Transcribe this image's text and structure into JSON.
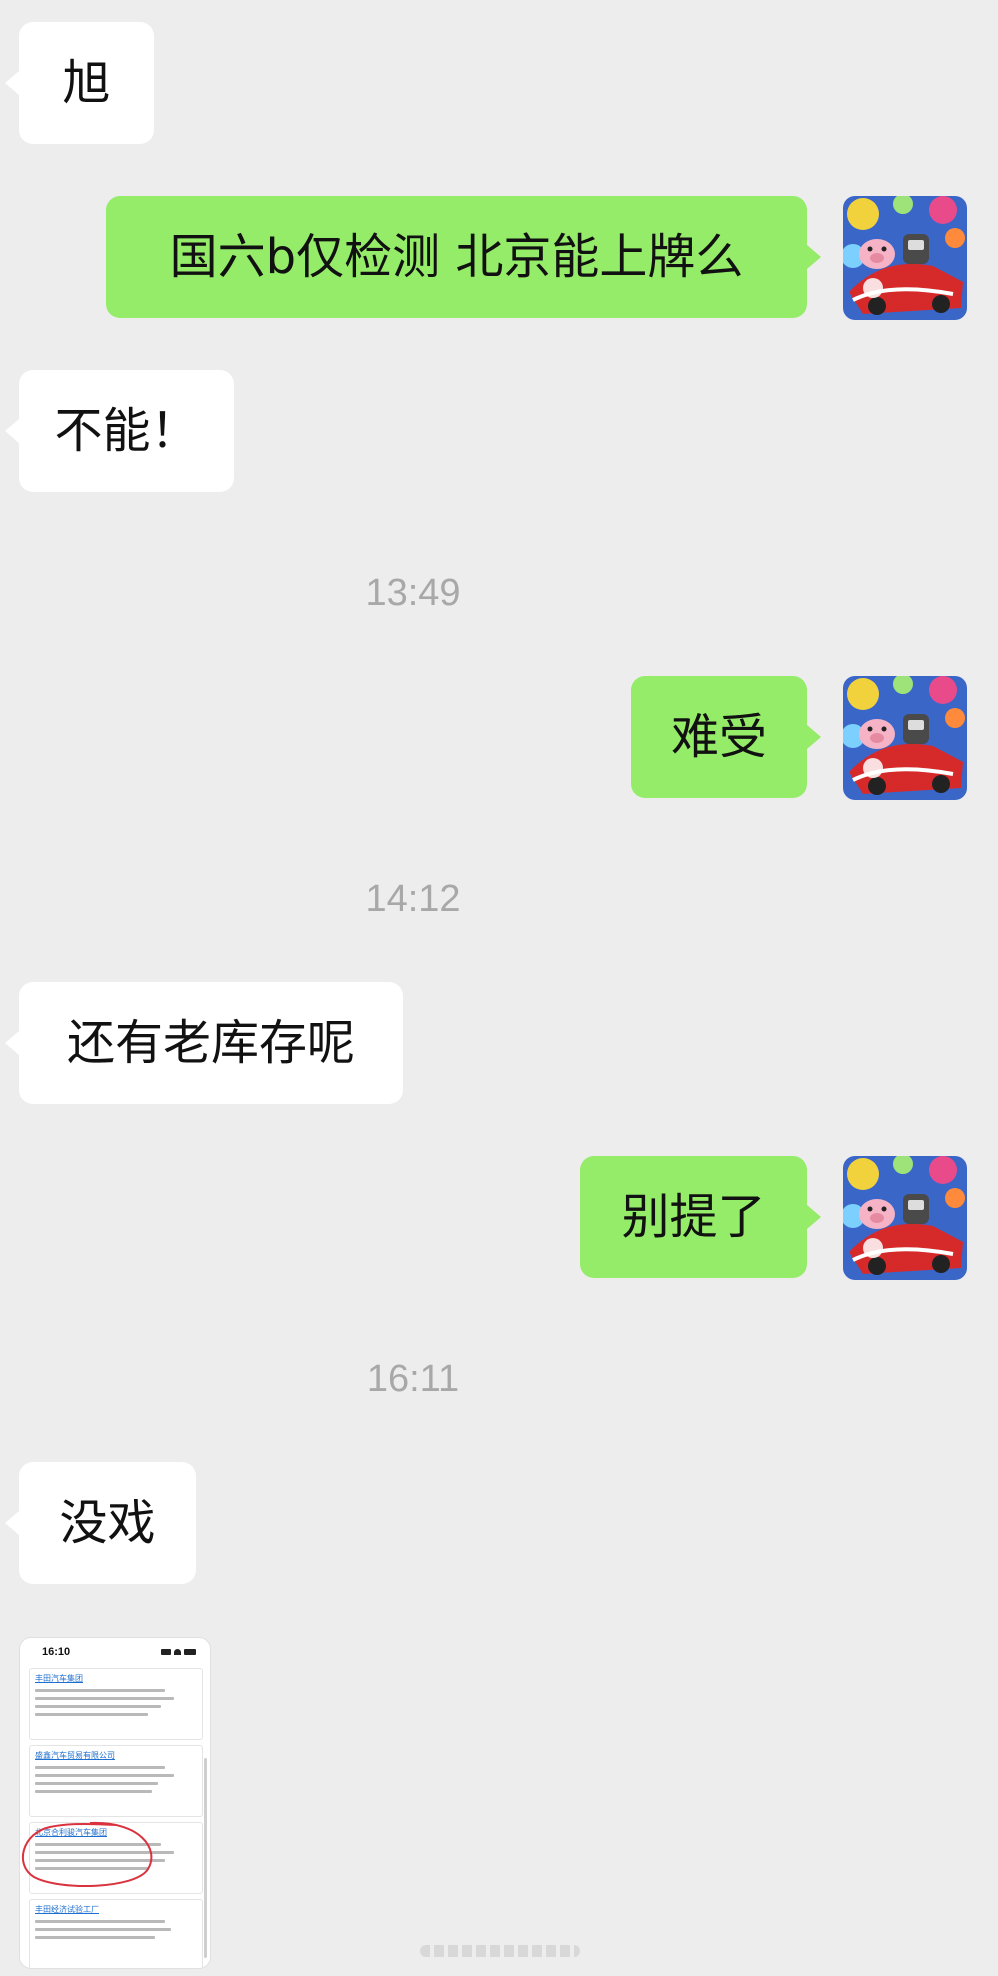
{
  "messages": [
    {
      "side": "left",
      "text": "旭"
    },
    {
      "side": "right",
      "text": "国六b仅检测 北京能上牌么"
    },
    {
      "side": "left",
      "text": "不能！"
    },
    {
      "side": "right",
      "text": "难受"
    },
    {
      "side": "left",
      "text": "还有老库存呢"
    },
    {
      "side": "right",
      "text": "别提了"
    },
    {
      "side": "left",
      "text": "没戏"
    }
  ],
  "timestamps": [
    "13:49",
    "14:12",
    "16:11"
  ],
  "avatar_icon": "pig-race-car-avatar",
  "colors": {
    "background": "#ededed",
    "incoming_bubble": "#ffffff",
    "outgoing_bubble": "#95ec69",
    "timestamp": "#a8a8a8"
  },
  "shared_image": {
    "status_time": "16:10",
    "cards": [
      {
        "title": "丰田汽车集团"
      },
      {
        "title": "盛鑫汽车贸易有限公司"
      },
      {
        "title": "北京合利骏汽车集团"
      },
      {
        "title": "丰田经济试验工厂"
      }
    ]
  }
}
